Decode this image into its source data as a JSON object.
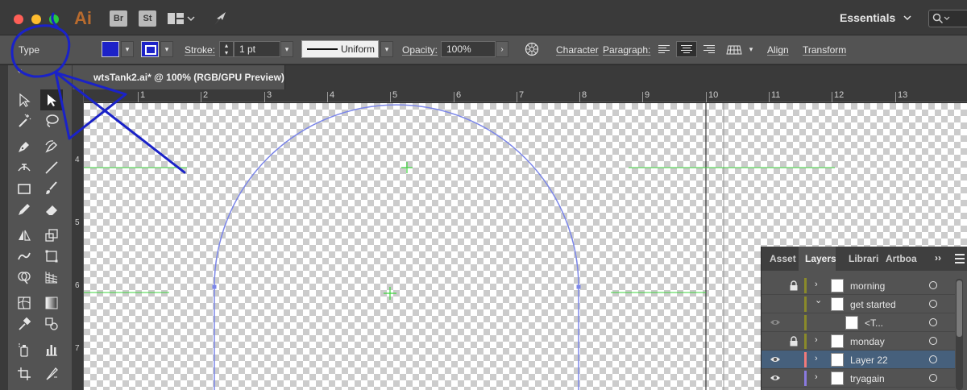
{
  "app": {
    "logo_text": "Ai",
    "bridge_label": "Br",
    "stock_label": "St",
    "workspace": "Essentials",
    "search_icon": "search-icon"
  },
  "control_bar": {
    "selection_type": "Type",
    "fill_color": "#1d22c8",
    "stroke_color": "#1d22c8",
    "stroke_label": "Stroke:",
    "stroke_weight": "1 pt",
    "profile": "Uniform",
    "opacity_label": "Opacity:",
    "opacity_value": "100%",
    "character_label": "Character",
    "paragraph_label": "Paragraph:",
    "align_label": "Align",
    "transform_label": "Transform"
  },
  "document": {
    "tab_title": "wtsTank2.ai* @ 100% (RGB/GPU Preview)"
  },
  "rulers": {
    "horizontal": [
      "1",
      "2",
      "3",
      "4",
      "5",
      "6",
      "7",
      "8",
      "9",
      "10",
      "11",
      "12",
      "13"
    ],
    "vertical": [
      "4",
      "5",
      "6",
      "7"
    ]
  },
  "layers_panel": {
    "tabs": [
      "Asset",
      "Layers",
      "Librari",
      "Artboa"
    ],
    "active_tab": "Layers",
    "rows": [
      {
        "name": "morning",
        "visible": false,
        "locked": true,
        "color": "#8a8a2a",
        "expanded": false,
        "indent": 0,
        "selected": false
      },
      {
        "name": "get started",
        "visible": false,
        "locked": false,
        "color": "#8a8a2a",
        "expanded": true,
        "indent": 0,
        "selected": false
      },
      {
        "name": "<T...",
        "visible": true,
        "dim": true,
        "locked": false,
        "color": "#8a8a2a",
        "expanded": null,
        "indent": 1,
        "selected": false
      },
      {
        "name": "monday",
        "visible": false,
        "locked": true,
        "color": "#8a8a2a",
        "expanded": false,
        "indent": 0,
        "selected": false
      },
      {
        "name": "Layer 22",
        "visible": true,
        "locked": false,
        "color": "#f07a7a",
        "expanded": false,
        "indent": 0,
        "selected": true
      },
      {
        "name": "tryagain",
        "visible": true,
        "locked": false,
        "color": "#8a7adf",
        "expanded": false,
        "indent": 0,
        "selected": false
      }
    ]
  },
  "colors": {
    "annotation": "#1a22c8",
    "guide": "#3dd43d",
    "path": "#7b86e8"
  }
}
